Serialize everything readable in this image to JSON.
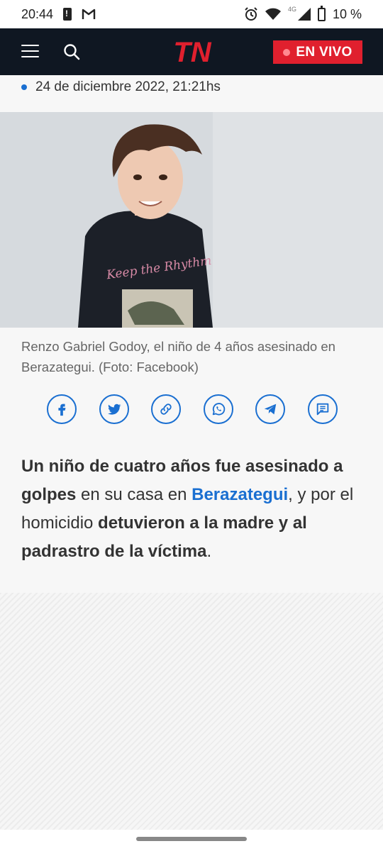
{
  "status_bar": {
    "time": "20:44",
    "network_label": "4G",
    "battery": "10 %"
  },
  "header": {
    "logo_text": "TN",
    "live_label": "EN VIVO",
    "colors": {
      "background": "#0f1722",
      "live": "#e0202e",
      "logo": "#e0202e"
    }
  },
  "article": {
    "date": "24 de diciembre 2022, 21:21hs",
    "caption": "Renzo Gabriel Godoy, el niño de 4 años asesinado en Berazategui. (Foto: Facebook)",
    "photo_shirt_text": "Keep the Rhythm",
    "share_buttons": [
      {
        "icon": "facebook-icon"
      },
      {
        "icon": "twitter-icon"
      },
      {
        "icon": "link-icon"
      },
      {
        "icon": "whatsapp-icon"
      },
      {
        "icon": "telegram-icon"
      },
      {
        "icon": "comments-icon"
      }
    ],
    "lead": {
      "part1_bold": "Un niño de cuatro años fue asesinado a golpes",
      "part2": " en su casa en ",
      "link_text": "Berazategui",
      "part3": ", y por el homicidio ",
      "part4_bold": "detuvieron a la madre y al padrastro de la víctima",
      "part5": "."
    },
    "accent_color": "#1a6fd1"
  }
}
